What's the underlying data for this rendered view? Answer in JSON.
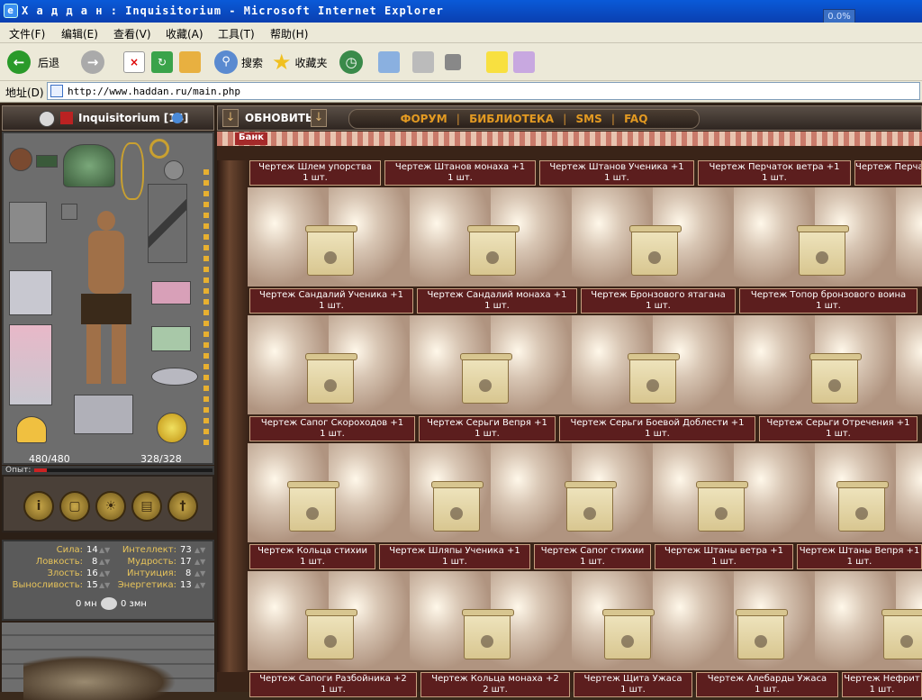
{
  "window": {
    "title": "Х а д д а н : Inquisitorium - Microsoft Internet Explorer",
    "progress": "0.0%"
  },
  "menu": [
    "文件(F)",
    "编辑(E)",
    "查看(V)",
    "收藏(A)",
    "工具(T)",
    "帮助(H)"
  ],
  "toolbar": {
    "back": "后退",
    "search": "搜索",
    "favorites": "收藏夹"
  },
  "address": {
    "label": "地址(D)",
    "url": "http://www.haddan.ru/main.php"
  },
  "character": {
    "name": "Inquisitorium [14]",
    "hp": "480/480",
    "mp": "328/328",
    "exp_label": "Опыт:"
  },
  "header": {
    "refresh": "ОБНОВИТЬ",
    "links": [
      "ФОРУМ",
      "БИБЛИОТЕКА",
      "SMS",
      "FAQ"
    ]
  },
  "stats": [
    {
      "label": "Сила:",
      "value": "14"
    },
    {
      "label": "Интеллект:",
      "value": "73"
    },
    {
      "label": "Ловкость:",
      "value": "8"
    },
    {
      "label": "Мудрость:",
      "value": "17"
    },
    {
      "label": "Злость:",
      "value": "16"
    },
    {
      "label": "Интуиция:",
      "value": "8"
    },
    {
      "label": "Выносливость:",
      "value": "15"
    },
    {
      "label": "Энергетика:",
      "value": "13"
    }
  ],
  "mana": {
    "mn": "0 мн",
    "zmn": "0 змн"
  },
  "bank": {
    "label": "Банк"
  },
  "rows": [
    [
      "Чертеж Шлем упорства",
      "Чертеж Штанов монаха +1",
      "Чертеж Штанов Ученика +1",
      "Чертеж Перчаток ветра +1",
      "Чертеж Перча"
    ],
    [
      "Чертеж Сандалий Ученика +1",
      "Чертеж Сандалий монаха +1",
      "Чертеж Бронзового ятагана",
      "Чертеж Топор бронзового воина"
    ],
    [
      "Чертеж Сапог Скороходов +1",
      "Чертеж Серьги Вепря +1",
      "Чертеж Серьги Боевой Доблести +1",
      "Чертеж Серьги Отречения +1"
    ],
    [
      "Чертеж Кольца стихии",
      "Чертеж Шляпы Ученика +1",
      "Чертеж Сапог стихии",
      "Чертеж Штаны ветра +1",
      "Чертеж Штаны Вепря +1"
    ],
    [
      "Чертеж Сапоги Разбойника +2",
      "Чертеж Кольца монаха +2",
      "Чертеж Щита Ужаса",
      "Чертеж Алебарды Ужаса",
      "Чертеж Нефрит"
    ]
  ],
  "quantities": [
    [
      "1 шт.",
      "1 шт.",
      "1 шт.",
      "1 шт."
    ],
    [
      "1 шт.",
      "1 шт.",
      "1 шт.",
      "1 шт."
    ],
    [
      "1 шт.",
      "1 шт.",
      "1 шт.",
      "1 шт."
    ],
    [
      "1 шт.",
      "1 шт.",
      "1 шт.",
      "1 шт.",
      "1 шт."
    ],
    [
      "1 шт.",
      "2 шт.",
      "1 шт.",
      "1 шт.",
      "1 шт."
    ]
  ]
}
